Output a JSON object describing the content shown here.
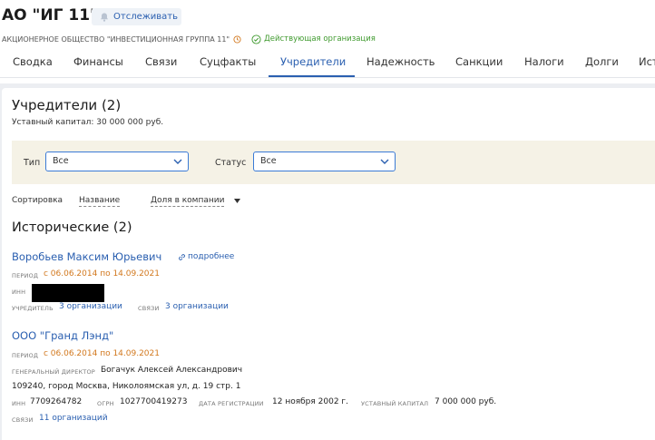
{
  "header": {
    "company_name": "АО \"ИГ 11\"",
    "follow_label": "Отслеживать",
    "full_name": "АКЦИОНЕРНОЕ ОБЩЕСТВО \"ИНВЕСТИЦИОННАЯ ГРУППА 11\"",
    "status": "Действующая организация"
  },
  "tabs": [
    {
      "label": "Сводка"
    },
    {
      "label": "Финансы"
    },
    {
      "label": "Связи"
    },
    {
      "label": "Суцфакты"
    },
    {
      "label": "Учредители"
    },
    {
      "label": "Надежность"
    },
    {
      "label": "Санкции"
    },
    {
      "label": "Налоги"
    },
    {
      "label": "Долги"
    },
    {
      "label": "Ист"
    }
  ],
  "active_tab": "Учредители",
  "founders": {
    "title": "Учредители (2)",
    "capital": "Уставный капитал: 30 000 000 руб.",
    "filters": {
      "type_label": "Тип",
      "type_value": "Все",
      "status_label": "Статус",
      "status_value": "Все"
    },
    "sort": {
      "label": "Сортировка",
      "option_name": "Название",
      "option_share": "Доля в компании"
    },
    "historical_title": "Исторические (2)",
    "entries": [
      {
        "name": "Воробьев Максим Юрьевич",
        "more": "подробнее",
        "period_label": "период",
        "period": "с 06.06.2014 по 14.09.2021",
        "inn_label": "инн",
        "founder_label": "учредитель",
        "founder_value": "3 организации",
        "links_label": "связи",
        "links_value": "3 организации"
      },
      {
        "name": "ООО \"Гранд Лэнд\"",
        "period_label": "период",
        "period": "с 06.06.2014 по 14.09.2021",
        "director_label": "генеральный директор",
        "director": "Богачук Алексей Александрович",
        "address": "109240, город Москва, Николоямская ул, д. 19 стр. 1",
        "inn_label": "инн",
        "inn": "7709264782",
        "ogrn_label": "огрн",
        "ogrn": "1027700419273",
        "reg_label": "дата регистрации",
        "reg_date": "12 ноября 2002 г.",
        "capital_label": "уставный капитал",
        "capital": "7 000 000 руб.",
        "links_label": "связи",
        "links_value": "11 организаций"
      }
    ]
  },
  "colors": {
    "accent": "#2a5fb0",
    "status_green": "#3f9a2e",
    "period_orange": "#d2781e",
    "filter_bg": "#f5f2e6"
  },
  "icons": [
    "bell-icon",
    "clock-icon",
    "check-circle-icon",
    "chevron-down-icon",
    "link-icon",
    "caret-down-icon"
  ]
}
